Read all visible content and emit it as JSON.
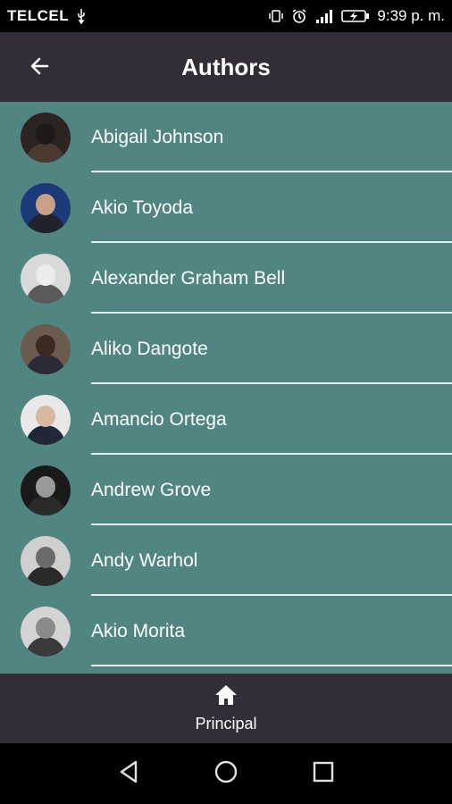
{
  "status_bar": {
    "carrier": "TELCEL",
    "time": "9:39 p. m.",
    "icons": [
      "usb-icon",
      "vibrate-icon",
      "alarm-icon",
      "signal-icon",
      "battery-charging-icon"
    ]
  },
  "app_bar": {
    "title": "Authors",
    "back_icon": "arrow-back-icon"
  },
  "authors": [
    {
      "name": "Abigail Johnson",
      "avatar_colors": [
        "#2b2420",
        "#1e1a18",
        "#4a3a30"
      ]
    },
    {
      "name": "Akio Toyoda",
      "avatar_colors": [
        "#1d3a78",
        "#c8a088",
        "#20232c"
      ]
    },
    {
      "name": "Alexander Graham Bell",
      "avatar_colors": [
        "#d9d9d9",
        "#ececec",
        "#5a5a5a"
      ]
    },
    {
      "name": "Aliko Dangote",
      "avatar_colors": [
        "#6b5a4e",
        "#3a2a22",
        "#2a2a38"
      ]
    },
    {
      "name": "Amancio Ortega",
      "avatar_colors": [
        "#e8e8e8",
        "#d6b8a0",
        "#202838"
      ]
    },
    {
      "name": "Andrew Grove",
      "avatar_colors": [
        "#1a1a1a",
        "#9a9a9a",
        "#2a2a2a"
      ]
    },
    {
      "name": "Andy Warhol",
      "avatar_colors": [
        "#cfcfcf",
        "#6a6a6a",
        "#2a2a2a"
      ]
    },
    {
      "name": "Akio Morita",
      "avatar_colors": [
        "#d4d4d4",
        "#8a8a8a",
        "#3a3a3a"
      ]
    }
  ],
  "bottom_nav": {
    "items": [
      {
        "label": "Principal",
        "icon": "home-icon"
      }
    ]
  },
  "system_nav": [
    "back-triangle-icon",
    "home-circle-icon",
    "recents-square-icon"
  ],
  "colors": {
    "app_bar": "#332d37",
    "list_background": "#508581",
    "divider": "#e6eeed"
  }
}
